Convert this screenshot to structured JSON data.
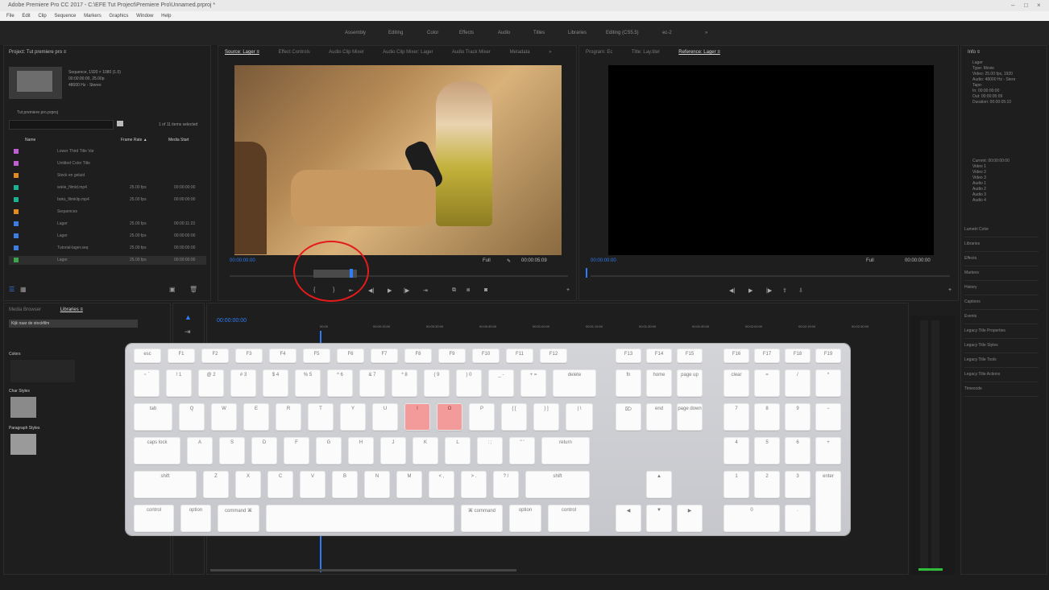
{
  "window": {
    "title": "Adobe Premiere Pro CC 2017 - C:\\EFE Tut Project\\Premiere Pro\\Unnamed.prproj *",
    "controls": [
      "–",
      "□",
      "×"
    ]
  },
  "menu": [
    "File",
    "Edit",
    "Clip",
    "Sequence",
    "Markers",
    "Graphics",
    "Window",
    "Help"
  ],
  "workspaces": [
    "Assembly",
    "Editing",
    "Color",
    "Effects",
    "Audio",
    "Titles",
    "Libraries",
    "Editing (CS5.5)",
    "ec-2",
    "»"
  ],
  "project": {
    "title": "Project: Tut premiere pro ≡",
    "info": [
      "Sequence, 1920 × 1080 (1.0)",
      "00:00:00:00, 25.00p",
      "48000 Hz - Stereo"
    ],
    "search_placeholder": "Tut premiere pro.prproj",
    "count": "1 of 11 items selected",
    "columns": {
      "name": "Name",
      "frame_rate": "Frame Rate ▲",
      "media_start": "Media Start"
    },
    "rows": [
      {
        "color": "#c05fd3",
        "name": "Lower Third Title Var",
        "dur": "",
        "start": ""
      },
      {
        "color": "#c05fd3",
        "name": "Untitled Color Title",
        "dur": "",
        "start": ""
      },
      {
        "color": "#e58a1f",
        "name": "Stock en geluid",
        "dur": "",
        "start": ""
      },
      {
        "color": "#1ab394",
        "name": "wiele_filmid.mp4",
        "dur": "25.00 fps",
        "start": "00:00:00:00"
      },
      {
        "color": "#1ab394",
        "name": "boks_filmklip.mp4",
        "dur": "25.00 fps",
        "start": "00:00:00:00"
      },
      {
        "color": "#e58a1f",
        "name": "Sequences",
        "dur": "",
        "start": ""
      },
      {
        "color": "#3d7ee6",
        "name": "Lager",
        "dur": "25.00 fps",
        "start": "00:00:11:23"
      },
      {
        "color": "#3d7ee6",
        "name": "Lager",
        "dur": "25.00 fps",
        "start": "00:00:00:00"
      },
      {
        "color": "#3d7ee6",
        "name": "Tutorial-lager.seq",
        "dur": "25.00 fps",
        "start": "00:00:00:00"
      },
      {
        "color": "#3aa84a",
        "name": "Lager",
        "dur": "25.00 fps",
        "start": "00:00:00:00"
      }
    ]
  },
  "source": {
    "tabs": [
      "Source: Lager ≡",
      "Effect Controls",
      "Audio Clip Mixer",
      "Audio Clip Mixer: Lager",
      "Audio Track Mixer",
      "Metadata",
      "»"
    ],
    "timecode_in": "00:00:00:00",
    "fit": "Full",
    "timecode_out": "00:00:05:09"
  },
  "program": {
    "tabs": [
      "Program: Ec",
      "Title: Lay.titel",
      "Reference: Lager ≡"
    ],
    "timecode_in": "00:00:00:00",
    "fit": "Full",
    "timecode_out": "00:00:00:00"
  },
  "info_panel": {
    "title": "Info ≡",
    "lines": [
      "Lager",
      "Type: Movie",
      "Video: 25.00 fps, 1920",
      "Audio: 48000 Hz - Stere",
      "Tape:",
      "In: 00:00:00:00",
      "Out: 00:00:05:09",
      "Duration: 00:00:05:10"
    ],
    "lines2": [
      "Current: 00:00:00:00",
      "Video 1",
      "Video 2",
      "Video 3",
      "Audio 1",
      "Audio 2",
      "Audio 3",
      "Audio 4"
    ]
  },
  "effects_list": [
    "Lumetri Color",
    "Libraries",
    "Effects",
    "Markers",
    "History",
    "Captions",
    "Events",
    "Legacy Title Properties",
    "Legacy Title Styles",
    "Legacy Title Tools",
    "Legacy Title Actions",
    "Timecode"
  ],
  "lower_left": {
    "tabs": [
      "Media Browser",
      "Libraries ≡"
    ],
    "search_text": "Kijk naar de stockfilm",
    "sections": [
      "Colors",
      "Char Styles",
      "Paragraph Styles"
    ]
  },
  "timeline": {
    "timecode": "00:00:00:00",
    "ruler": [
      "00:00",
      "00:00:15:00",
      "00:00:30:00",
      "00:00:45:00",
      "00:01:00:00",
      "00:01:15:00",
      "00:01:30:00",
      "00:01:45:00",
      "00:02:00:00",
      "00:02:15:00",
      "00:02:30:00"
    ]
  },
  "keyboard": {
    "row_fn": [
      "esc",
      "F1",
      "F2",
      "F3",
      "F4",
      "F5",
      "F6",
      "F7",
      "F8",
      "F9",
      "F10",
      "F11",
      "F12",
      "F13",
      "F14",
      "F15",
      "F16",
      "F17",
      "F18",
      "F19"
    ],
    "row_num": [
      "~ `",
      "! 1",
      "@ 2",
      "# 3",
      "$ 4",
      "% 5",
      "^ 6",
      "& 7",
      "* 8",
      "( 9",
      ") 0",
      "_ -",
      "+ =",
      "delete"
    ],
    "row_q": [
      "tab",
      "Q",
      "W",
      "E",
      "R",
      "T",
      "Y",
      "U",
      "I",
      "O",
      "P",
      "{ [",
      "} ]",
      "| \\"
    ],
    "row_a": [
      "caps lock",
      "A",
      "S",
      "D",
      "F",
      "G",
      "H",
      "J",
      "K",
      "L",
      ": ;",
      "\" '",
      "return"
    ],
    "row_z": [
      "shift",
      "Z",
      "X",
      "C",
      "V",
      "B",
      "N",
      "M",
      "< ,",
      "> .",
      "? /",
      "shift"
    ],
    "row_sp": [
      "fn",
      "control",
      "option",
      "command ⌘",
      "",
      "⌘ command",
      "option",
      "control"
    ],
    "nav_top": [
      "fn",
      "home",
      "page up"
    ],
    "nav_mid": [
      "⌦",
      "end",
      "page down"
    ],
    "arrows": [
      "▲",
      "◀",
      "▼",
      "▶"
    ],
    "numpad_top": [
      "clear",
      "=",
      "/",
      "*"
    ],
    "numpad_r1": [
      "7",
      "8",
      "9",
      "−"
    ],
    "numpad_r2": [
      "4",
      "5",
      "6",
      "+"
    ],
    "numpad_r3": [
      "1",
      "2",
      "3"
    ],
    "numpad_r4": [
      "0",
      ".",
      "enter"
    ],
    "highlighted": [
      "I",
      "O"
    ],
    "highlight_color": "#f39a9a"
  }
}
